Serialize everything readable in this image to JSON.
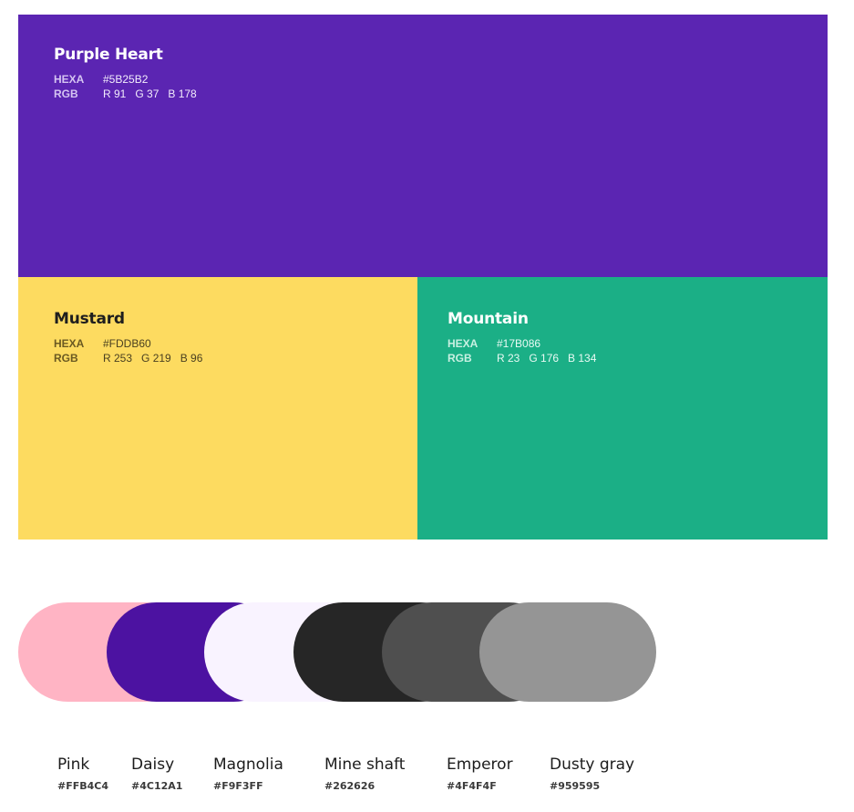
{
  "blocks": {
    "purple": {
      "name": "Purple Heart",
      "hexa_label": "HEXA",
      "hexa": "#5B25B2",
      "rgb_label": "RGB",
      "rgb": "R 91   G 37   B 178",
      "bg": "#5B25B2",
      "title_color": "#FFFFFF",
      "key_color": "#D5C4F2",
      "val_color": "#F2ECFC"
    },
    "mustard": {
      "name": "Mustard",
      "hexa_label": "HEXA",
      "hexa": "#FDDB60",
      "rgb_label": "RGB",
      "rgb": "R 253   G 219   B 96",
      "bg": "#FDDB60",
      "title_color": "#1E1E1E",
      "key_color": "#6B5A22",
      "val_color": "#4A4020"
    },
    "mountain": {
      "name": "Mountain",
      "hexa_label": "HEXA",
      "hexa": "#17B086",
      "rgb_label": "RGB",
      "rgb": "R 23   G 176   B 134",
      "bg": "#1BAF86",
      "title_color": "#FFFFFF",
      "key_color": "#C8F0E2",
      "val_color": "#E9FAF4"
    }
  },
  "swatches": [
    {
      "name": "Pink",
      "hex": "#FFB4C4",
      "color": "#FFB4C4"
    },
    {
      "name": "Daisy",
      "hex": "#4C12A1",
      "color": "#4C12A1"
    },
    {
      "name": "Magnolia",
      "hex": "#F9F3FF",
      "color": "#F9F3FF"
    },
    {
      "name": "Mine shaft",
      "hex": "#262626",
      "color": "#262626"
    },
    {
      "name": "Emperor",
      "hex": "#4F4F4F",
      "color": "#4F4F4F"
    },
    {
      "name": "Dusty gray",
      "hex": "#959595",
      "color": "#959595"
    }
  ]
}
